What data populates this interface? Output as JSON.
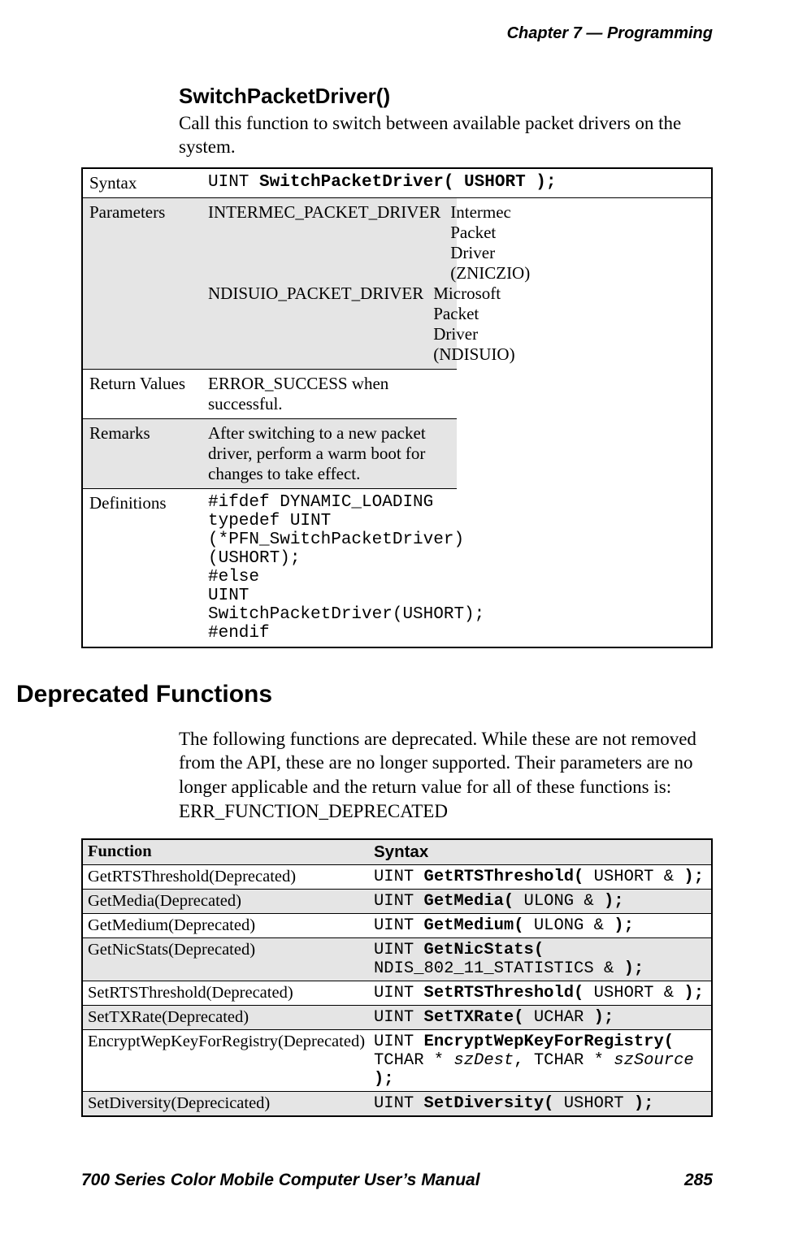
{
  "header": {
    "chapter_word": "Chapter",
    "chapter_num": "7",
    "dash": "—",
    "title": "Programming"
  },
  "func": {
    "title": "SwitchPacketDriver()",
    "desc": "Call this function to switch between available packet drivers on the system."
  },
  "api_table": {
    "rows": {
      "syntax_label": "Syntax",
      "syntax_code_pre": "UINT ",
      "syntax_code_bold": "SwitchPacketDriver( USHORT );",
      "parameters_label": "Parameters",
      "param1_key": "INTERMEC_PACKET_DRIVER",
      "param1_val": "Intermec Packet Driver (ZNICZIO)",
      "param2_key": "NDISUIO_PACKET_DRIVER",
      "param2_val": "Microsoft Packet Driver (NDISUIO)",
      "return_label": "Return Values",
      "return_val": "ERROR_SUCCESS when successful.",
      "remarks_label": "Remarks",
      "remarks_val": "After switching to a new packet driver, perform a warm boot for changes to take effect.",
      "defs_label": "Definitions",
      "defs_code": "#ifdef DYNAMIC_LOADING\ntypedef UINT (*PFN_SwitchPacketDriver)(USHORT);\n#else\nUINT SwitchPacketDriver(USHORT);\n#endif"
    }
  },
  "deprecated": {
    "heading": "Deprecated Functions",
    "para": "The following functions are deprecated. While these are not removed from the API, these are no longer supported. Their parameters are no longer applicable and the return value for all of these functions is: ERR_FUNCTION_DEPRECATED",
    "th_function": "Function",
    "th_syntax": "Syntax",
    "rows": [
      {
        "func": "GetRTSThreshold(Deprecated)",
        "pre": "UINT ",
        "bold": "GetRTSThreshold(",
        "args": " USHORT & ",
        "tailbold": ");",
        "shade": false
      },
      {
        "func": "GetMedia(Deprecated)",
        "pre": "UINT ",
        "bold": "GetMedia(",
        "args": " ULONG & ",
        "tailbold": ");",
        "shade": true
      },
      {
        "func": "GetMedium(Deprecated)",
        "pre": "UINT ",
        "bold": "GetMedium(",
        "args": " ULONG & ",
        "tailbold": ");",
        "shade": false
      },
      {
        "func": "GetNicStats(Deprecated)",
        "pre": "UINT ",
        "bold": "GetNicStats(",
        "args": " NDIS_802_11_STATISTICS & ",
        "tailbold": ");",
        "shade": true
      },
      {
        "func": "SetRTSThreshold(Deprecated)",
        "pre": "UINT ",
        "bold": "SetRTSThreshold(",
        "args": " USHORT & ",
        "tailbold": ");",
        "shade": false
      },
      {
        "func": "SetTXRate(Deprecated)",
        "pre": "UINT ",
        "bold": "SetTXRate(",
        "args": " UCHAR ",
        "tailbold": ");",
        "shade": true
      },
      {
        "func": "EncryptWepKeyForRegistry(Deprecated)",
        "pre": "UINT ",
        "bold": "EncryptWepKeyForRegistry(",
        "args": " TCHAR * ",
        "arg_it1": "szDest",
        "mid": ", TCHAR * ",
        "arg_it2": "szSource",
        "post": " ",
        "tailbold": ");",
        "shade": false
      },
      {
        "func": "SetDiversity(Deprecicated)",
        "pre": "UINT ",
        "bold": "SetDiversity(",
        "args": " USHORT ",
        "tailbold": ");",
        "shade": true
      }
    ]
  },
  "footer": {
    "left": "700 Series Color Mobile Computer User’s Manual",
    "right": "285"
  }
}
